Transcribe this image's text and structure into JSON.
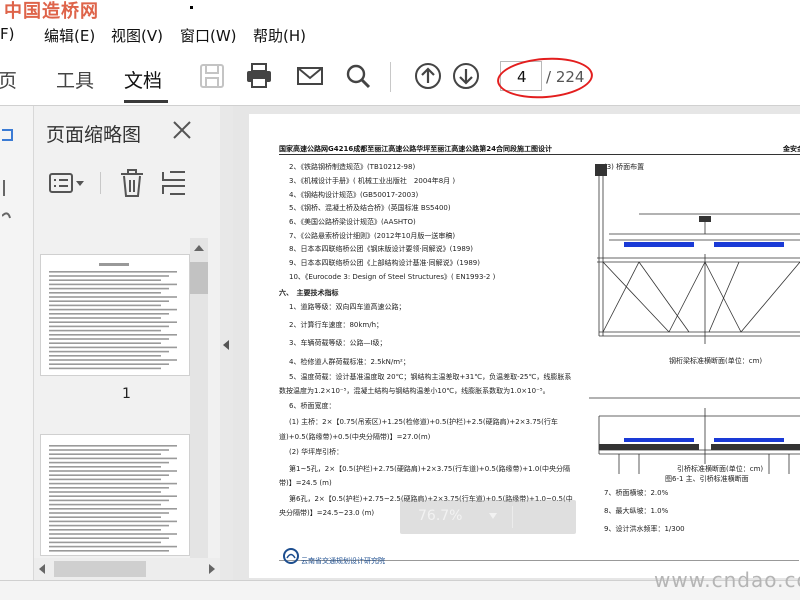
{
  "watermark_top": "中国造桥网",
  "watermark_bottom": "www.cndao.com",
  "menu": [
    {
      "label": "F)"
    },
    {
      "label": "编辑(E)"
    },
    {
      "label": "视图(V)"
    },
    {
      "label": "窗口(W)"
    },
    {
      "label": "帮助(H)"
    }
  ],
  "toolbar": {
    "tabs": [
      "页",
      "工具",
      "文档"
    ],
    "page_current": "4",
    "page_total": "/ 224",
    "icons": [
      "save-icon",
      "print-icon",
      "mail-icon",
      "search-icon",
      "up-arrow-icon",
      "down-arrow-icon"
    ]
  },
  "thumbnails": {
    "title": "页面缩略图",
    "page_label": "1"
  },
  "zoom": {
    "value": "76.7%"
  },
  "document": {
    "header_left": "国家高速公路网G4216成都至丽江高速公路华坪至丽江高速公路第24合同段施工图设计",
    "header_right": "金安金沙江大桥…",
    "lines": [
      "2、《铁路钢桥制造规范》(TB10212-98)",
      "3、《机械设计手册》( 机械工业出版社　2004年8月 )",
      "4、《钢结构设计规范》(GB50017-2003)",
      "5、《钢桥、混凝土桥及结合桥》(英国标准 BS5400)",
      "6、《美国公路桥梁设计规范》(AASHTO)",
      "7、《公路悬索桥设计细则》(2012年10月版一送审稿)",
      "8、日本本四联络桥公团《钢床版设计要领·同解说》(1989)",
      "9、日本本四联络桥公团《上部结构设计基准·同解说》(1989)",
      "10、《Eurocode 3: Design of Steel Structures》( EN1993-2 )",
      "六、　主要技术指标",
      "1、道路等级：双向四车道高速公路；",
      "2、计算行车速度：80km/h；",
      "3、车辆荷载等级：公路—Ⅰ级；",
      "4、检修道人群荷载标准：2.5kN/m²；",
      "5、温度荷载：设计基准温度取 20℃；钢结构主温差取+31℃，负温差取-25℃，线膨胀系",
      "数按温度为1.2×10⁻⁵，混凝土结构与钢结构温差小10℃，线膨胀系数取为1.0×10⁻⁵。",
      "6、桥面宽度：",
      "(1) 主桥：2×【0.75(吊索区)+1.25(检修道)+0.5(护栏)+2.5(硬路肩)+2×3.75(行车",
      "道)+0.5(路缘带)+0.5(中央分隔带)】=27.0(m)",
      "(2) 华坪岸引桥：",
      "第1~5孔，2×【0.5(护栏)+2.75(硬路肩)+2×3.75(行车道)+0.5(路缘带)+1.0(中央分隔",
      "带)】=24.5 (m)",
      "第6孔，2×【0.5(护栏)+2.75~2.5(硬路肩)+2×3.75(行车道)+0.5(路缘带)+1.0~0.5(中",
      "央分隔带)】=24.5~23.0 (m)"
    ],
    "right_lines": [
      "(3) 桥面布置",
      "钢桁梁标准横断面(单位：cm)",
      "引桥标准横断面(单位：cm)",
      "图6-1 主、引桥标准横断面",
      "7、桥面横坡：2.0%",
      "8、最大纵坡：1.0%",
      "9、设计洪水频率：1/300"
    ],
    "footer_logo": "云南省交通规划设计研究院"
  }
}
